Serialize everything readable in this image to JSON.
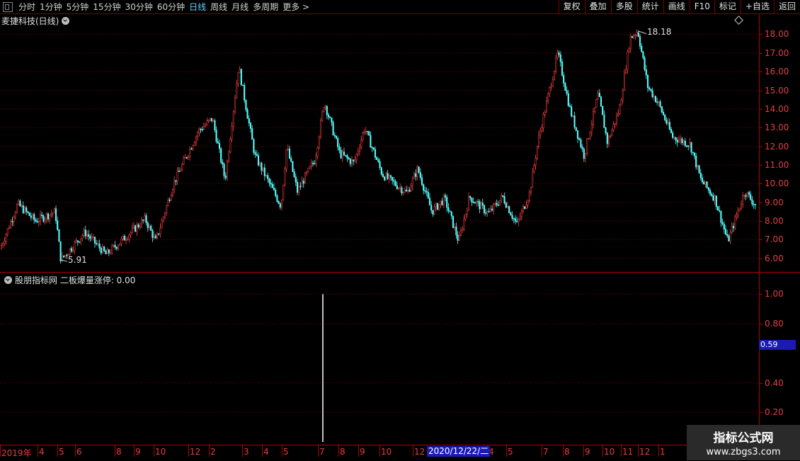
{
  "toolbar": {
    "periods": [
      "分时",
      "1分钟",
      "5分钟",
      "15分钟",
      "30分钟",
      "60分钟",
      "日线",
      "周线",
      "月线",
      "多周期",
      "更多 >"
    ],
    "active_period": "日线",
    "right_buttons": [
      "复权",
      "叠加",
      "多股",
      "统计",
      "画线",
      "F10",
      "标记",
      "+自选",
      "返回"
    ]
  },
  "main_panel": {
    "title": "麦捷科技(日线)",
    "high_label": "18.18",
    "low_label": "5.91",
    "y_ticks": [
      "18.00",
      "17.00",
      "16.00",
      "15.00",
      "14.00",
      "13.00",
      "12.00",
      "11.00",
      "10.00",
      "9.00",
      "8.00",
      "7.00",
      "6.00"
    ]
  },
  "indicator_panel": {
    "title": "股朋指标网 二板爆量涨停: 0.00",
    "y_ticks": [
      "1.00",
      "0.80",
      "0.40",
      "0.20"
    ],
    "cursor_value": "0.59"
  },
  "x_axis": {
    "labels": [
      "2019年",
      "4",
      "5",
      "6",
      "8",
      "9",
      "10",
      "12",
      "2",
      "3",
      "4",
      "5",
      "7",
      "8",
      "9",
      "10",
      "12",
      "4",
      "5",
      "7",
      "8",
      "9",
      "10",
      "11",
      "12",
      "1"
    ],
    "selected_date": "2020/12/22/二"
  },
  "watermark": {
    "line1": "指标公式网",
    "line2": "www.zbgs3.com"
  },
  "chart_data": {
    "type": "candlestick",
    "y_range": [
      5.5,
      18.7
    ],
    "indicator_range": [
      0,
      1.05
    ],
    "key_points": [
      {
        "x": 0,
        "y": 6.5
      },
      {
        "x": 25,
        "y": 8.9
      },
      {
        "x": 50,
        "y": 8.0
      },
      {
        "x": 78,
        "y": 8.5
      },
      {
        "x": 86,
        "y": 5.91
      },
      {
        "x": 120,
        "y": 7.4
      },
      {
        "x": 150,
        "y": 6.2
      },
      {
        "x": 205,
        "y": 8.1
      },
      {
        "x": 220,
        "y": 6.9
      },
      {
        "x": 245,
        "y": 10.0
      },
      {
        "x": 280,
        "y": 12.8
      },
      {
        "x": 300,
        "y": 13.5
      },
      {
        "x": 318,
        "y": 10.2
      },
      {
        "x": 337,
        "y": 16.3
      },
      {
        "x": 360,
        "y": 11.5
      },
      {
        "x": 397,
        "y": 8.8
      },
      {
        "x": 405,
        "y": 12.0
      },
      {
        "x": 420,
        "y": 9.6
      },
      {
        "x": 445,
        "y": 11.3
      },
      {
        "x": 458,
        "y": 14.4
      },
      {
        "x": 480,
        "y": 11.6
      },
      {
        "x": 500,
        "y": 11.1
      },
      {
        "x": 515,
        "y": 13.0
      },
      {
        "x": 540,
        "y": 10.5
      },
      {
        "x": 575,
        "y": 9.5
      },
      {
        "x": 590,
        "y": 10.8
      },
      {
        "x": 610,
        "y": 8.5
      },
      {
        "x": 628,
        "y": 9.2
      },
      {
        "x": 648,
        "y": 6.9
      },
      {
        "x": 663,
        "y": 9.3
      },
      {
        "x": 690,
        "y": 8.4
      },
      {
        "x": 710,
        "y": 9.3
      },
      {
        "x": 730,
        "y": 7.8
      },
      {
        "x": 748,
        "y": 9.5
      },
      {
        "x": 760,
        "y": 12.3
      },
      {
        "x": 788,
        "y": 17.0
      },
      {
        "x": 805,
        "y": 14.0
      },
      {
        "x": 825,
        "y": 11.5
      },
      {
        "x": 845,
        "y": 14.8
      },
      {
        "x": 858,
        "y": 12.2
      },
      {
        "x": 875,
        "y": 14.0
      },
      {
        "x": 890,
        "y": 17.8
      },
      {
        "x": 901,
        "y": 18.18
      },
      {
        "x": 915,
        "y": 15.2
      },
      {
        "x": 930,
        "y": 14.3
      },
      {
        "x": 950,
        "y": 12.5
      },
      {
        "x": 975,
        "y": 12.1
      },
      {
        "x": 990,
        "y": 10.2
      },
      {
        "x": 1010,
        "y": 9.2
      },
      {
        "x": 1028,
        "y": 6.9
      },
      {
        "x": 1052,
        "y": 9.6
      },
      {
        "x": 1070,
        "y": 8.7
      }
    ],
    "indicator_spike": {
      "x": 456,
      "value": 1.0
    }
  }
}
